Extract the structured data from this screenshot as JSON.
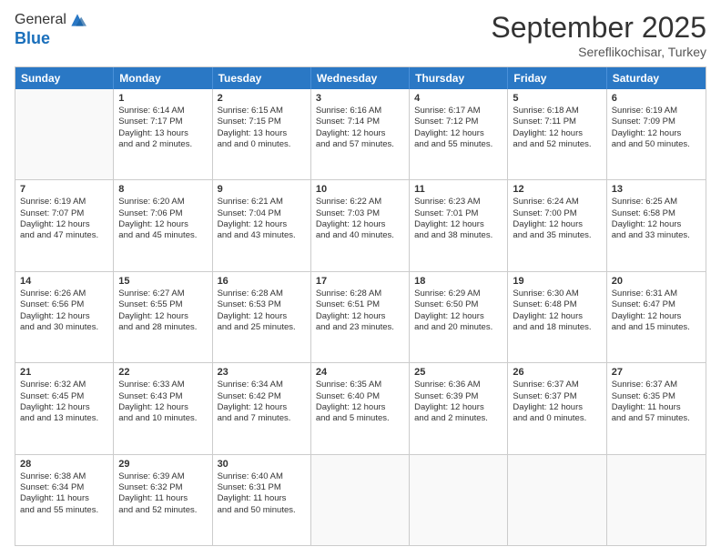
{
  "logo": {
    "general": "General",
    "blue": "Blue"
  },
  "header": {
    "month": "September 2025",
    "location": "Sereflikochisar, Turkey"
  },
  "days": [
    "Sunday",
    "Monday",
    "Tuesday",
    "Wednesday",
    "Thursday",
    "Friday",
    "Saturday"
  ],
  "weeks": [
    [
      {
        "day": "",
        "empty": true
      },
      {
        "day": "1",
        "sunrise": "Sunrise: 6:14 AM",
        "sunset": "Sunset: 7:17 PM",
        "daylight": "Daylight: 13 hours and 2 minutes."
      },
      {
        "day": "2",
        "sunrise": "Sunrise: 6:15 AM",
        "sunset": "Sunset: 7:15 PM",
        "daylight": "Daylight: 13 hours and 0 minutes."
      },
      {
        "day": "3",
        "sunrise": "Sunrise: 6:16 AM",
        "sunset": "Sunset: 7:14 PM",
        "daylight": "Daylight: 12 hours and 57 minutes."
      },
      {
        "day": "4",
        "sunrise": "Sunrise: 6:17 AM",
        "sunset": "Sunset: 7:12 PM",
        "daylight": "Daylight: 12 hours and 55 minutes."
      },
      {
        "day": "5",
        "sunrise": "Sunrise: 6:18 AM",
        "sunset": "Sunset: 7:11 PM",
        "daylight": "Daylight: 12 hours and 52 minutes."
      },
      {
        "day": "6",
        "sunrise": "Sunrise: 6:19 AM",
        "sunset": "Sunset: 7:09 PM",
        "daylight": "Daylight: 12 hours and 50 minutes."
      }
    ],
    [
      {
        "day": "7",
        "sunrise": "Sunrise: 6:19 AM",
        "sunset": "Sunset: 7:07 PM",
        "daylight": "Daylight: 12 hours and 47 minutes."
      },
      {
        "day": "8",
        "sunrise": "Sunrise: 6:20 AM",
        "sunset": "Sunset: 7:06 PM",
        "daylight": "Daylight: 12 hours and 45 minutes."
      },
      {
        "day": "9",
        "sunrise": "Sunrise: 6:21 AM",
        "sunset": "Sunset: 7:04 PM",
        "daylight": "Daylight: 12 hours and 43 minutes."
      },
      {
        "day": "10",
        "sunrise": "Sunrise: 6:22 AM",
        "sunset": "Sunset: 7:03 PM",
        "daylight": "Daylight: 12 hours and 40 minutes."
      },
      {
        "day": "11",
        "sunrise": "Sunrise: 6:23 AM",
        "sunset": "Sunset: 7:01 PM",
        "daylight": "Daylight: 12 hours and 38 minutes."
      },
      {
        "day": "12",
        "sunrise": "Sunrise: 6:24 AM",
        "sunset": "Sunset: 7:00 PM",
        "daylight": "Daylight: 12 hours and 35 minutes."
      },
      {
        "day": "13",
        "sunrise": "Sunrise: 6:25 AM",
        "sunset": "Sunset: 6:58 PM",
        "daylight": "Daylight: 12 hours and 33 minutes."
      }
    ],
    [
      {
        "day": "14",
        "sunrise": "Sunrise: 6:26 AM",
        "sunset": "Sunset: 6:56 PM",
        "daylight": "Daylight: 12 hours and 30 minutes."
      },
      {
        "day": "15",
        "sunrise": "Sunrise: 6:27 AM",
        "sunset": "Sunset: 6:55 PM",
        "daylight": "Daylight: 12 hours and 28 minutes."
      },
      {
        "day": "16",
        "sunrise": "Sunrise: 6:28 AM",
        "sunset": "Sunset: 6:53 PM",
        "daylight": "Daylight: 12 hours and 25 minutes."
      },
      {
        "day": "17",
        "sunrise": "Sunrise: 6:28 AM",
        "sunset": "Sunset: 6:51 PM",
        "daylight": "Daylight: 12 hours and 23 minutes."
      },
      {
        "day": "18",
        "sunrise": "Sunrise: 6:29 AM",
        "sunset": "Sunset: 6:50 PM",
        "daylight": "Daylight: 12 hours and 20 minutes."
      },
      {
        "day": "19",
        "sunrise": "Sunrise: 6:30 AM",
        "sunset": "Sunset: 6:48 PM",
        "daylight": "Daylight: 12 hours and 18 minutes."
      },
      {
        "day": "20",
        "sunrise": "Sunrise: 6:31 AM",
        "sunset": "Sunset: 6:47 PM",
        "daylight": "Daylight: 12 hours and 15 minutes."
      }
    ],
    [
      {
        "day": "21",
        "sunrise": "Sunrise: 6:32 AM",
        "sunset": "Sunset: 6:45 PM",
        "daylight": "Daylight: 12 hours and 13 minutes."
      },
      {
        "day": "22",
        "sunrise": "Sunrise: 6:33 AM",
        "sunset": "Sunset: 6:43 PM",
        "daylight": "Daylight: 12 hours and 10 minutes."
      },
      {
        "day": "23",
        "sunrise": "Sunrise: 6:34 AM",
        "sunset": "Sunset: 6:42 PM",
        "daylight": "Daylight: 12 hours and 7 minutes."
      },
      {
        "day": "24",
        "sunrise": "Sunrise: 6:35 AM",
        "sunset": "Sunset: 6:40 PM",
        "daylight": "Daylight: 12 hours and 5 minutes."
      },
      {
        "day": "25",
        "sunrise": "Sunrise: 6:36 AM",
        "sunset": "Sunset: 6:39 PM",
        "daylight": "Daylight: 12 hours and 2 minutes."
      },
      {
        "day": "26",
        "sunrise": "Sunrise: 6:37 AM",
        "sunset": "Sunset: 6:37 PM",
        "daylight": "Daylight: 12 hours and 0 minutes."
      },
      {
        "day": "27",
        "sunrise": "Sunrise: 6:37 AM",
        "sunset": "Sunset: 6:35 PM",
        "daylight": "Daylight: 11 hours and 57 minutes."
      }
    ],
    [
      {
        "day": "28",
        "sunrise": "Sunrise: 6:38 AM",
        "sunset": "Sunset: 6:34 PM",
        "daylight": "Daylight: 11 hours and 55 minutes."
      },
      {
        "day": "29",
        "sunrise": "Sunrise: 6:39 AM",
        "sunset": "Sunset: 6:32 PM",
        "daylight": "Daylight: 11 hours and 52 minutes."
      },
      {
        "day": "30",
        "sunrise": "Sunrise: 6:40 AM",
        "sunset": "Sunset: 6:31 PM",
        "daylight": "Daylight: 11 hours and 50 minutes."
      },
      {
        "day": "",
        "empty": true
      },
      {
        "day": "",
        "empty": true
      },
      {
        "day": "",
        "empty": true
      },
      {
        "day": "",
        "empty": true
      }
    ]
  ]
}
